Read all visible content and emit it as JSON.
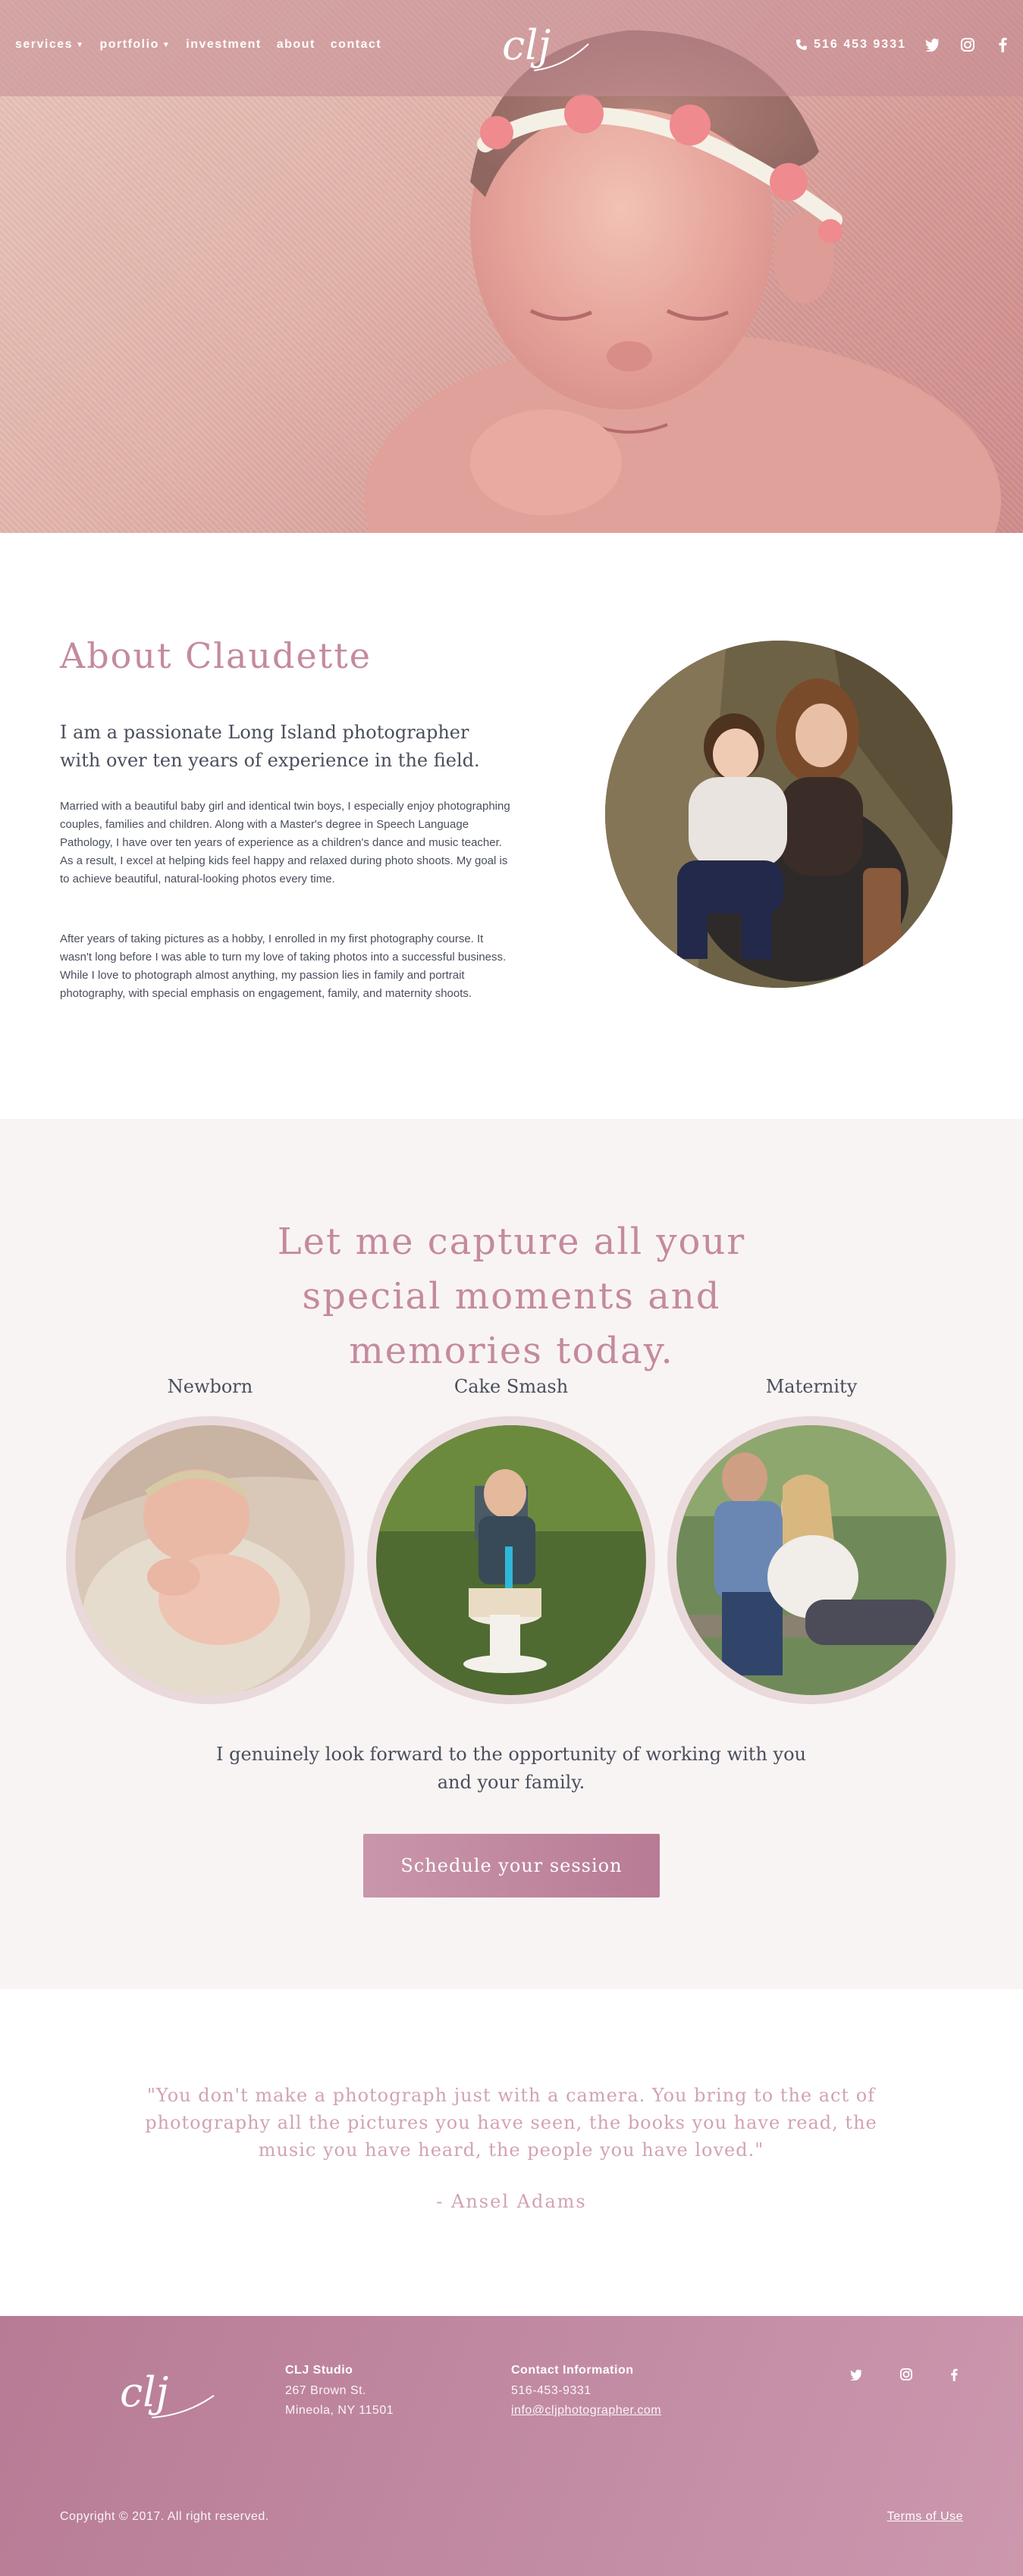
{
  "nav": {
    "items": [
      {
        "label": "services",
        "has_dropdown": true
      },
      {
        "label": "portfolio",
        "has_dropdown": true
      },
      {
        "label": "investment",
        "has_dropdown": false
      },
      {
        "label": "about",
        "has_dropdown": false
      },
      {
        "label": "contact",
        "has_dropdown": false
      }
    ],
    "logo_text": "clj",
    "phone": "516 453 9331",
    "social_icons": [
      "twitter-icon",
      "instagram-icon",
      "facebook-icon"
    ]
  },
  "about": {
    "heading": "About Claudette",
    "lead": "I am a passionate Long Island photographer with over ten years of experience in the field.",
    "paragraphs": [
      "Married with a beautiful baby girl and identical twin boys, I especially enjoy photographing couples, families and children. Along with a Master's degree in Speech Language Pathology, I have over ten years of experience as a children's dance and music teacher. As a result, I excel at helping kids feel happy and relaxed during photo shoots. My goal is to achieve beautiful, natural-looking photos every time.",
      "After years of taking pictures as a hobby, I enrolled in my first photography course. It wasn't long before I was able to turn my love of taking photos into a successful business. While I love to photograph almost anything, my passion lies in family and portrait photography, with special emphasis on engagement, family, and maternity shoots."
    ]
  },
  "services": {
    "heading": "Let me capture all your special moments and memories today.",
    "items": [
      {
        "title": "Newborn"
      },
      {
        "title": "Cake Smash"
      },
      {
        "title": "Maternity"
      }
    ],
    "text": "I genuinely look forward to the opportunity of working with you and your family.",
    "button_label": "Schedule your session"
  },
  "quote": {
    "text": "\"You don't make a photograph just with a camera. You bring to the act of photography all the pictures you have seen, the books you have read, the music you have heard, the people you have loved.\"",
    "author": "- Ansel Adams"
  },
  "footer": {
    "studio": {
      "title": "CLJ Studio",
      "address1": "267 Brown St.",
      "address2": "Mineola, NY 11501"
    },
    "contact": {
      "title": "Contact Information",
      "phone": "516-453-9331",
      "email": "info@cljphotographer.com"
    },
    "copyright": "Copyright © 2017. All right reserved.",
    "terms": "Terms of Use"
  },
  "colors": {
    "accent": "#c48a9e",
    "text": "#4a4f5c",
    "footer": "#c28ba4",
    "section_bg": "#f9f4f4"
  }
}
